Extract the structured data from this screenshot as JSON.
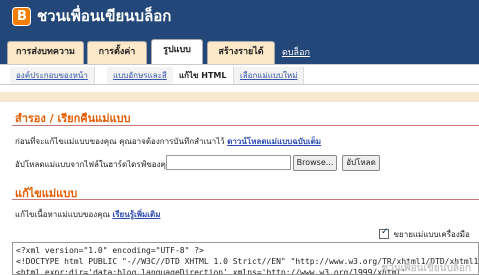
{
  "header": {
    "title": "ชวนเพื่อนเขียนบล็อก"
  },
  "tabs": [
    {
      "label": "การส่งบทความ"
    },
    {
      "label": "การตั้งค่า"
    },
    {
      "label": "รูปแบบ"
    },
    {
      "label": "สร้างรายได้"
    }
  ],
  "dashboard_link": "ดบล็อก",
  "subtabs": [
    {
      "label": "องค์ประกอบของหน้า"
    },
    {
      "label": "แบบอักษรและสี"
    },
    {
      "label": "แก้ไข HTML"
    },
    {
      "label": "เลือกแม่แบบใหม่"
    }
  ],
  "backup": {
    "heading": "สำรอง / เรียกคืนแม่แบบ",
    "desc": "ก่อนที่จะแก้ไขแม่แบบของคุณ คุณอาจต้องการบันทึกสำเนาไว้",
    "download_link": "ดาวน์โหลดแม่แบบฉบับเต็ม",
    "upload_label": "อัปโหลดแม่แบบจากไฟล์ในฮาร์ดไดรฟ์ของคุณ:",
    "browse_label": "Browse...",
    "upload_button": "อัปโหลด"
  },
  "edit": {
    "heading": "แก้ไขแม่แบบ",
    "desc": "แก้ไขเนื้อหาแม่แบบของคุณ",
    "learn_more": "เรียนรู้เพิ่มเติม",
    "expand_label": "ขยายแม่แบบเครื่องมือ"
  },
  "code_lines": [
    "<?xml version=\"1.0\" encoding=\"UTF-8\" ?>",
    "<!DOCTYPE html PUBLIC \"-//W3C//DTD XHTML 1.0 Strict//EN\" \"http://www.w3.org/TR/xhtml1/DTD/xhtml1-strict.dtd\">",
    "<html expr:dir='data:blog.languageDirection' xmlns='http://www.w3.org/1999/xhtml'"
  ],
  "watermark": "ชวนเพื่อนเขียนบล็อก"
}
